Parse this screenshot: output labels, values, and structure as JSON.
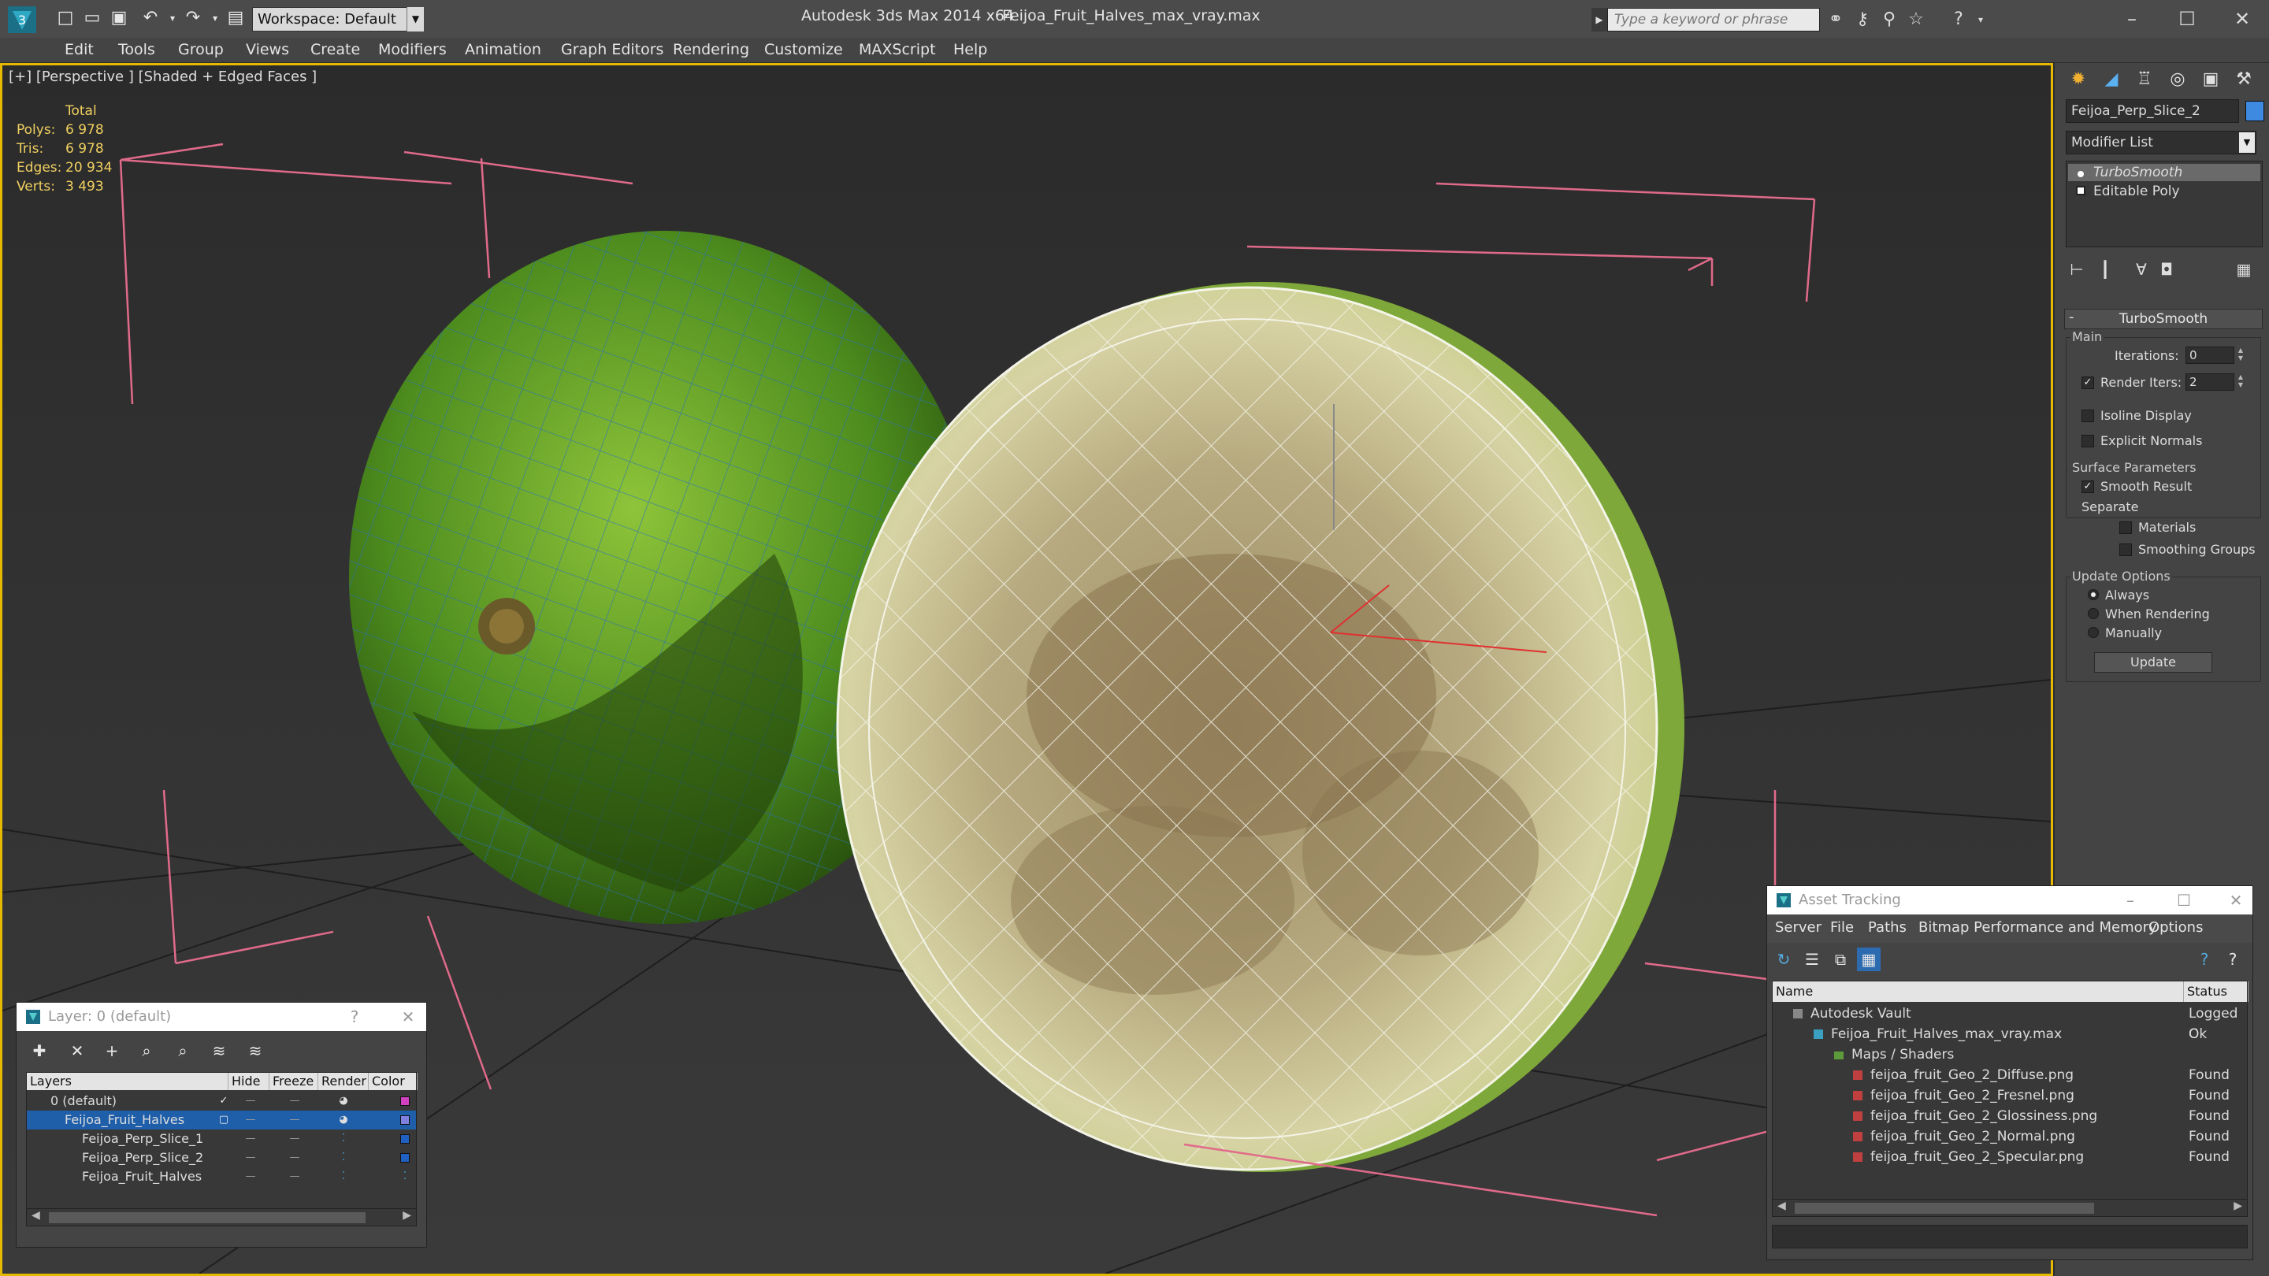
{
  "window": {
    "app_title": "Autodesk 3ds Max 2014 x64",
    "file_title": "Feijoa_Fruit_Halves_max_vray.max",
    "workspace": "Workspace: Default",
    "search_placeholder": "Type a keyword or phrase"
  },
  "menu": [
    "Edit",
    "Tools",
    "Group",
    "Views",
    "Create",
    "Modifiers",
    "Animation",
    "Graph Editors",
    "Rendering",
    "Customize",
    "MAXScript",
    "Help"
  ],
  "viewport": {
    "label": "[+] [Perspective ] [Shaded + Edged Faces ]",
    "stats": {
      "header": "Total",
      "rows": [
        {
          "label": "Polys:",
          "value": "6 978"
        },
        {
          "label": "Tris:",
          "value": "6 978"
        },
        {
          "label": "Edges:",
          "value": "20 934"
        },
        {
          "label": "Verts:",
          "value": "3 493"
        }
      ]
    }
  },
  "command_panel": {
    "object_name": "Feijoa_Perp_Slice_2",
    "object_color": "#3e8ae0",
    "modifier_list": "Modifier List",
    "stack": [
      "TurboSmooth",
      "Editable Poly"
    ],
    "rollout_title": "TurboSmooth",
    "main_group": "Main",
    "iterations_label": "Iterations:",
    "iterations_value": "0",
    "render_iters_label": "Render Iters:",
    "render_iters_value": "2",
    "isoline_display": "Isoline Display",
    "explicit_normals": "Explicit Normals",
    "surface_group": "Surface Parameters",
    "smooth_result": "Smooth Result",
    "separate": "Separate",
    "materials": "Materials",
    "smoothing_groups": "Smoothing Groups",
    "update_group": "Update Options",
    "always": "Always",
    "when_rendering": "When Rendering",
    "manually": "Manually",
    "update_button": "Update"
  },
  "layer_window": {
    "title": "Layer: 0 (default)",
    "help": "?",
    "columns": [
      "Layers",
      "Hide",
      "Freeze",
      "Render",
      "Color"
    ],
    "rows": [
      {
        "name": "0 (default)",
        "color": "#d040c0"
      },
      {
        "name": "Feijoa_Fruit_Halves",
        "color": "#8080e0"
      },
      {
        "name": "Feijoa_Perp_Slice_1",
        "color": "#2060c0"
      },
      {
        "name": "Feijoa_Perp_Slice_2",
        "color": "#2060c0"
      },
      {
        "name": "Feijoa_Fruit_Halves",
        "color": ""
      }
    ]
  },
  "asset_window": {
    "title": "Asset Tracking",
    "menu": [
      "Server",
      "File",
      "Paths",
      "Bitmap Performance and Memory",
      "Options"
    ],
    "columns": [
      "Name",
      "Status"
    ],
    "rows": [
      {
        "name": "Autodesk Vault",
        "status": "Logged C"
      },
      {
        "name": "Feijoa_Fruit_Halves_max_vray.max",
        "status": "Ok"
      },
      {
        "name": "Maps / Shaders",
        "status": ""
      },
      {
        "name": "feijoa_fruit_Geo_2_Diffuse.png",
        "status": "Found"
      },
      {
        "name": "feijoa_fruit_Geo_2_Fresnel.png",
        "status": "Found"
      },
      {
        "name": "feijoa_fruit_Geo_2_Glossiness.png",
        "status": "Found"
      },
      {
        "name": "feijoa_fruit_Geo_2_Normal.png",
        "status": "Found"
      },
      {
        "name": "feijoa_fruit_Geo_2_Specular.png",
        "status": "Found"
      }
    ]
  }
}
